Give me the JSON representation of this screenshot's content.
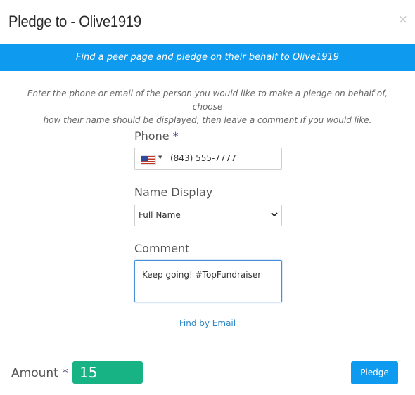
{
  "header": {
    "title": "Pledge to - Olive1919",
    "close_glyph": "×"
  },
  "banner": {
    "text": "Find a peer page and pledge on their behalf to Olive1919"
  },
  "instructions": {
    "line1": "Enter the phone or email of the person you would like to make a pledge on behalf of, choose",
    "line2": "how their name should be displayed, then leave a comment if you would like."
  },
  "form": {
    "phone": {
      "label": "Phone",
      "required_mark": "*",
      "country_flag": "us-flag-icon",
      "value": "(843) 555-7777"
    },
    "name_display": {
      "label": "Name Display",
      "selected": "Full Name"
    },
    "comment": {
      "label": "Comment",
      "value": "Keep going! #TopFundraiser"
    },
    "find_by_email": "Find by Email"
  },
  "footer": {
    "amount_label": "Amount",
    "required_mark": "*",
    "amount_value": "15",
    "pledge_button": "Pledge"
  },
  "colors": {
    "accent_blue": "#0d9aef",
    "amount_green": "#17b384",
    "required_purple": "#5b3a7e",
    "link_blue": "#2a86c7"
  }
}
